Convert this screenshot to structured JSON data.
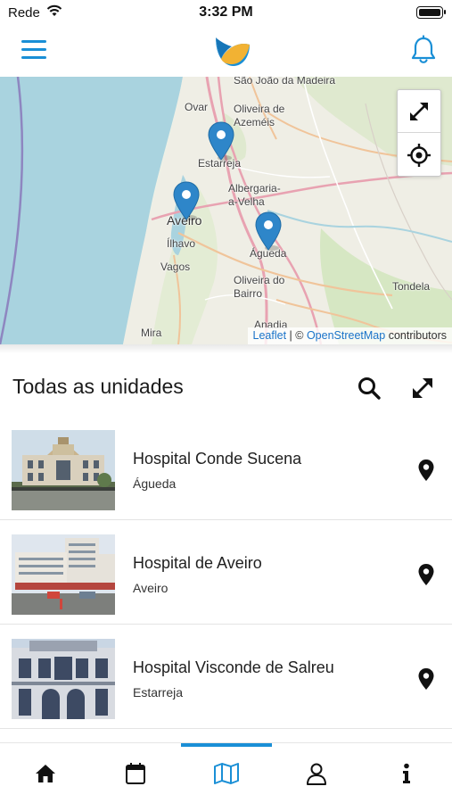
{
  "status_bar": {
    "carrier": "Rede",
    "time": "3:32 PM"
  },
  "header": {
    "menu_icon": "hamburger-menu-icon",
    "logo": "app-logo",
    "notification_icon": "bell-icon"
  },
  "map": {
    "labels": [
      "São João da Madeira",
      "Ovar",
      "Oliveira de Azeméis",
      "Estarreja",
      "Albergaria-a-Velha",
      "Aveiro",
      "Ílhavo",
      "Vagos",
      "Águeda",
      "Oliveira do Bairro",
      "Tondela",
      "Anadia",
      "Mira"
    ],
    "controls": {
      "fullscreen_icon": "expand-arrows-icon",
      "locate_icon": "crosshair-locate-icon"
    },
    "attribution": {
      "leaflet": "Leaflet",
      "separator": "| ©",
      "osm": "OpenStreetMap",
      "suffix": "contributors"
    },
    "marker_color": "#2e86c9"
  },
  "list": {
    "title": "Todas as unidades",
    "search_icon": "search-icon",
    "expand_icon": "expand-icon",
    "items": [
      {
        "name": "Hospital Conde Sucena",
        "location": "Águeda"
      },
      {
        "name": "Hospital de Aveiro",
        "location": "Aveiro"
      },
      {
        "name": "Hospital Visconde de Salreu",
        "location": "Estarreja"
      }
    ]
  },
  "tabbar": {
    "tabs": [
      "home-icon",
      "calendar-icon",
      "map-icon",
      "user-icon",
      "info-icon"
    ],
    "active": "map-icon",
    "accent": "#1a8fd6"
  }
}
